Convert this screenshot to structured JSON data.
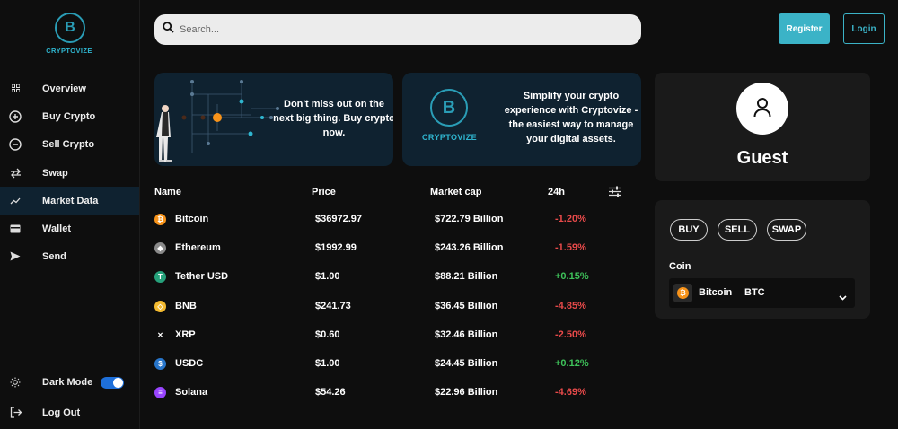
{
  "brand": {
    "name": "CRYPTOVIZE",
    "logo_letter": "B"
  },
  "sidebar": {
    "items": [
      {
        "label": "Overview",
        "icon": "grid-icon"
      },
      {
        "label": "Buy Crypto",
        "icon": "plus-circle-icon"
      },
      {
        "label": "Sell Crypto",
        "icon": "minus-circle-icon"
      },
      {
        "label": "Swap",
        "icon": "swap-arrows-icon"
      },
      {
        "label": "Market Data",
        "icon": "trend-line-icon",
        "active": true
      },
      {
        "label": "Wallet",
        "icon": "wallet-icon"
      },
      {
        "label": "Send",
        "icon": "send-icon"
      }
    ],
    "dark_mode_label": "Dark Mode",
    "dark_mode_on": true,
    "logout_label": "Log Out"
  },
  "search": {
    "placeholder": "Search..."
  },
  "header": {
    "register_label": "Register",
    "login_label": "Login"
  },
  "banners": {
    "first": {
      "text_line1": "Don't miss out on the",
      "text_line2": "next big thing. Buy crypto",
      "text_line3": "now."
    },
    "second": {
      "logo_text": "CRYPTOVIZE",
      "text_line1": "Simplify your crypto",
      "text_line2": "experience with Cryptovize -",
      "text_line3": "the easiest way to manage",
      "text_line4": "your digital assets."
    }
  },
  "market_table": {
    "headers": {
      "name": "Name",
      "price": "Price",
      "market_cap": "Market cap",
      "change": "24h"
    },
    "rows": [
      {
        "name": "Bitcoin",
        "price": "$36972.97",
        "market_cap": "$722.79 Billion",
        "change": "-1.20%",
        "trend": "neg",
        "color": "#f7931a",
        "icon": "bitcoin-icon",
        "glyph": "₿"
      },
      {
        "name": "Ethereum",
        "price": "$1992.99",
        "market_cap": "$243.26 Billion",
        "change": "-1.59%",
        "trend": "neg",
        "color": "#8a8a8a",
        "icon": "ethereum-icon",
        "glyph": "◆"
      },
      {
        "name": "Tether USD",
        "price": "$1.00",
        "market_cap": "$88.21 Billion",
        "change": "+0.15%",
        "trend": "pos",
        "color": "#26a17b",
        "icon": "tether-icon",
        "glyph": "T"
      },
      {
        "name": "BNB",
        "price": "$241.73",
        "market_cap": "$36.45 Billion",
        "change": "-4.85%",
        "trend": "neg",
        "color": "#f3ba2f",
        "icon": "bnb-icon",
        "glyph": "◇"
      },
      {
        "name": "XRP",
        "price": "$0.60",
        "market_cap": "$32.46 Billion",
        "change": "-2.50%",
        "trend": "neg",
        "color": "#0e0e0e",
        "icon": "xrp-icon",
        "glyph": "✕"
      },
      {
        "name": "USDC",
        "price": "$1.00",
        "market_cap": "$24.45 Billion",
        "change": "+0.12%",
        "trend": "pos",
        "color": "#2775ca",
        "icon": "usdc-icon",
        "glyph": "$"
      },
      {
        "name": "Solana",
        "price": "$54.26",
        "market_cap": "$22.96 Billion",
        "change": "-4.69%",
        "trend": "neg",
        "color": "#9945ff",
        "icon": "solana-icon",
        "glyph": "≡"
      }
    ]
  },
  "profile": {
    "name": "Guest"
  },
  "trade": {
    "buy_label": "BUY",
    "sell_label": "SELL",
    "swap_label": "SWAP",
    "coin_label": "Coin",
    "selected_coin": {
      "name": "Bitcoin",
      "symbol": "BTC"
    }
  },
  "colors": {
    "accent": "#3bb3c7",
    "negative": "#e84a4a",
    "positive": "#3ec25a",
    "banner_bg": "#0f2230"
  }
}
